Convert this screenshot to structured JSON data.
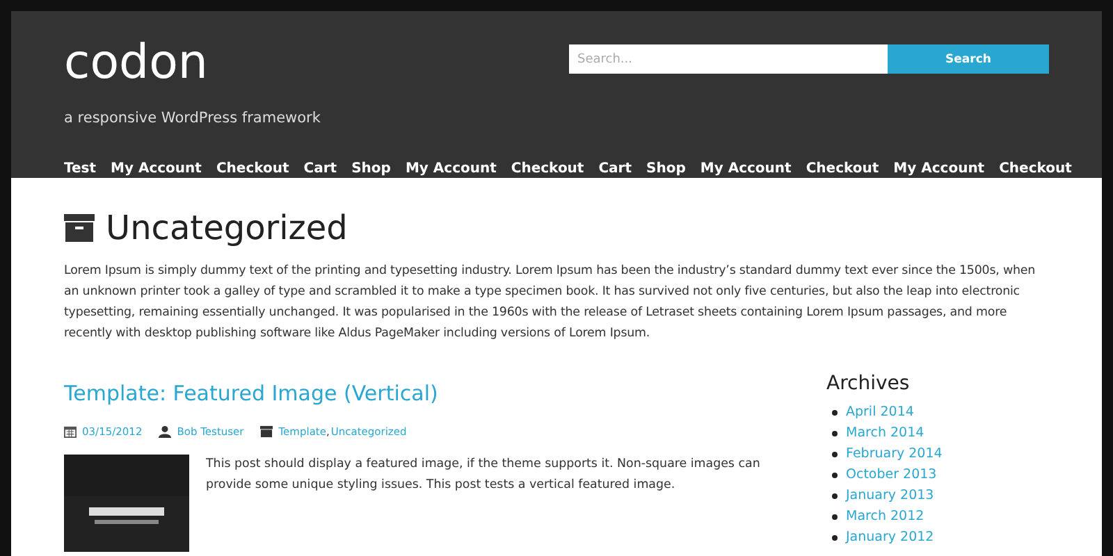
{
  "site": {
    "title": "codon",
    "tagline": "a responsive WordPress framework"
  },
  "search": {
    "placeholder": "Search...",
    "button": "Search"
  },
  "nav": [
    "Test",
    "My Account",
    "Checkout",
    "Cart",
    "Shop",
    "My Account",
    "Checkout",
    "Cart",
    "Shop",
    "My Account",
    "Checkout",
    "My Account",
    "Checkout"
  ],
  "archive": {
    "title": "Uncategorized",
    "description": "Lorem Ipsum is simply dummy text of the printing and typesetting industry. Lorem Ipsum has been the industry’s standard dummy text ever since the 1500s, when an unknown printer took a galley of type and scrambled it to make a type specimen book. It has survived not only five centuries, but also the leap into electronic typesetting, remaining essentially unchanged. It was popularised in the 1960s with the release of Letraset sheets containing Lorem Ipsum passages, and more recently with desktop publishing software like Aldus PageMaker including versions of Lorem Ipsum."
  },
  "post": {
    "title": "Template: Featured Image (Vertical)",
    "date": "03/15/2012",
    "author": "Bob Testuser",
    "categories": [
      "Template",
      "Uncategorized"
    ],
    "category_separator": ",",
    "excerpt": "This post should display a featured image, if the theme supports it. Non-square images can provide some unique styling issues. This post tests a vertical featured image."
  },
  "sidebar": {
    "title": "Archives",
    "items": [
      "April 2014",
      "March 2014",
      "February 2014",
      "October 2013",
      "January 2013",
      "March 2012",
      "January 2012"
    ]
  }
}
